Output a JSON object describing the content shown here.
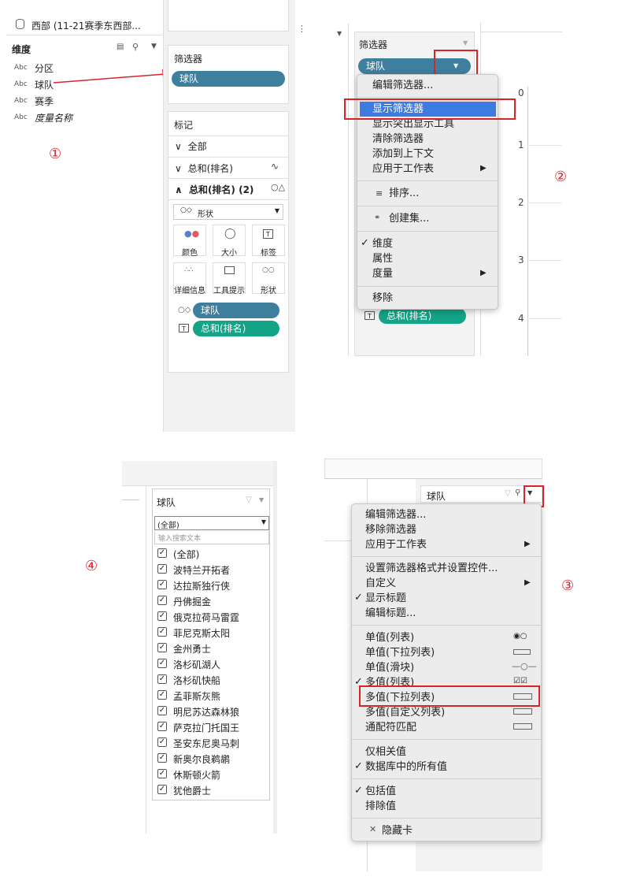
{
  "p1": {
    "badge": "①",
    "datasource": "西部 (11-21赛季东西部...",
    "dims_header": "维度",
    "fields": [
      {
        "type": "Abc",
        "name": "分区"
      },
      {
        "type": "Abc",
        "name": "球队"
      },
      {
        "type": "Abc",
        "name": "赛季"
      },
      {
        "type": "Abc",
        "name": "度量名称"
      }
    ],
    "filters_title": "筛选器",
    "filter_pill": "球队",
    "marks_title": "标记",
    "marks_rows": [
      "全部",
      "总和(排名)",
      "总和(排名) (2)"
    ],
    "mark_type": "形状",
    "cards": [
      "颜色",
      "大小",
      "标签",
      "详细信息",
      "工具提示",
      "形状"
    ],
    "pills": [
      "球队",
      "总和(排名)"
    ]
  },
  "p2": {
    "badge": "②",
    "filters_title": "筛选器",
    "filter_pill": "球队",
    "menu": [
      "编辑筛选器...",
      "显示筛选器",
      "显示突出显示工具",
      "清除筛选器",
      "添加到上下文",
      "应用于工作表",
      "排序...",
      "创建集...",
      "维度",
      "属性",
      "度量",
      "移除"
    ],
    "ticks": [
      "0",
      "1",
      "2",
      "3",
      "4"
    ],
    "bottom_pill": "总和(排名)"
  },
  "p3": {
    "badge": "③",
    "card_title": "球队",
    "menu": [
      "编辑筛选器...",
      "移除筛选器",
      "应用于工作表",
      "设置筛选器格式并设置控件...",
      "自定义",
      "显示标题",
      "编辑标题...",
      "单值(列表)",
      "单值(下拉列表)",
      "单值(滑块)",
      "多值(列表)",
      "多值(下拉列表)",
      "多值(自定义列表)",
      "通配符匹配",
      "仅相关值",
      "数据库中的所有值",
      "包括值",
      "排除值",
      "隐藏卡"
    ]
  },
  "p4": {
    "badge": "④",
    "card_title": "球队",
    "dropdown_value": "(全部)",
    "search_placeholder": "输入搜索文本",
    "items": [
      "(全部)",
      "波特兰开拓者",
      "达拉斯独行侠",
      "丹佛掘金",
      "俄克拉荷马雷霆",
      "菲尼克斯太阳",
      "金州勇士",
      "洛杉矶湖人",
      "洛杉矶快船",
      "孟菲斯灰熊",
      "明尼苏达森林狼",
      "萨克拉门托国王",
      "圣安东尼奥马刺",
      "新奥尔良鹈鹕",
      "休斯顿火箭",
      "犹他爵士"
    ]
  },
  "colors": {
    "pill_blue": "#3f7f9e",
    "pill_green": "#13a386",
    "highlight": "#3d7be0",
    "annotation_red": "#d9232b"
  }
}
